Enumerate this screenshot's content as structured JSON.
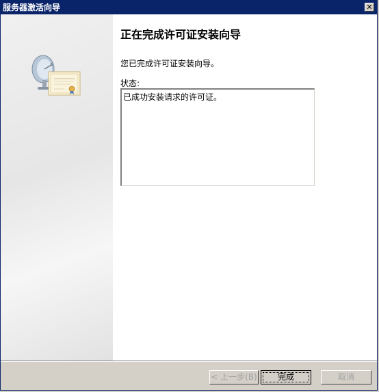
{
  "window": {
    "title": "服务器激活向导",
    "close_glyph": "✕"
  },
  "main": {
    "title": "正在完成许可证安装向导",
    "intro": "您已完成许可证安装向导。",
    "status_label": "状态:",
    "status_text": "已成功安装请求的许可证。"
  },
  "buttons": {
    "back": "< 上一步(B)",
    "finish": "完成",
    "cancel": "取消"
  },
  "icons": {
    "illustration": "satellite-certificate-icon"
  },
  "colors": {
    "titlebar": "#0a246a",
    "dialog_bg": "#d4d0c8"
  }
}
